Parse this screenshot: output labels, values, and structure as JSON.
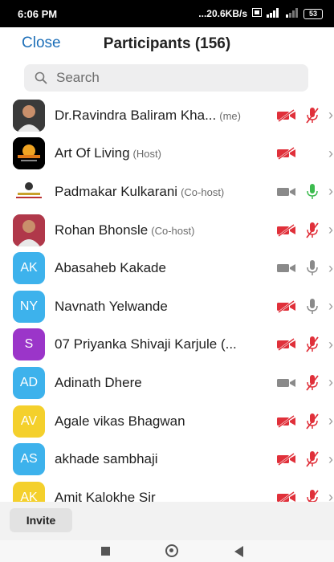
{
  "status_bar": {
    "time": "6:06 PM",
    "net_speed": "...20.6KB/s",
    "battery": "53"
  },
  "header": {
    "close_label": "Close",
    "title": "Participants (156)"
  },
  "search": {
    "placeholder": "Search"
  },
  "colors": {
    "accent_blue": "#1d6fb8",
    "muted_red": "#e0303a",
    "mic_green": "#3dbb4f",
    "icon_gray": "#8a8a8a"
  },
  "participants": [
    {
      "name": "Dr.Ravindra Baliram Kha...",
      "role": "(me)",
      "avatar_type": "photo",
      "avatar_bg": "#3a3a3a",
      "video": "off",
      "mic": "muted"
    },
    {
      "name": "Art Of Living",
      "role": "(Host)",
      "avatar_type": "logo",
      "avatar_bg": "#000000",
      "video": "off",
      "mic": "none"
    },
    {
      "name": "Padmakar Kulkarani",
      "role": "(Co-host)",
      "avatar_type": "logo-light",
      "avatar_bg": "#ffffff",
      "video": "on",
      "mic": "active"
    },
    {
      "name": "Rohan Bhonsle",
      "role": "(Co-host)",
      "avatar_type": "photo",
      "avatar_bg": "#b0384a",
      "video": "off",
      "mic": "muted"
    },
    {
      "name": "Abasaheb Kakade",
      "role": "",
      "avatar_type": "initials",
      "initials": "AK",
      "avatar_bg": "#3db2ec",
      "video": "on",
      "mic": "on"
    },
    {
      "name": "Navnath Yelwande",
      "role": "",
      "avatar_type": "initials",
      "initials": "NY",
      "avatar_bg": "#3db2ec",
      "video": "off",
      "mic": "on"
    },
    {
      "name": "07 Priyanka Shivaji Karjule (...",
      "role": "",
      "avatar_type": "initials",
      "initials": "S",
      "avatar_bg": "#9b35c9",
      "video": "off",
      "mic": "muted"
    },
    {
      "name": "Adinath Dhere",
      "role": "",
      "avatar_type": "initials",
      "initials": "AD",
      "avatar_bg": "#3db2ec",
      "video": "on",
      "mic": "muted"
    },
    {
      "name": "Agale vikas Bhagwan",
      "role": "",
      "avatar_type": "initials",
      "initials": "AV",
      "avatar_bg": "#f4d02c",
      "video": "off",
      "mic": "muted"
    },
    {
      "name": "akhade sambhaji",
      "role": "",
      "avatar_type": "initials",
      "initials": "AS",
      "avatar_bg": "#3db2ec",
      "video": "off",
      "mic": "muted"
    },
    {
      "name": "Amit Kalokhe Sir",
      "role": "",
      "avatar_type": "initials",
      "initials": "AK",
      "avatar_bg": "#f4d02c",
      "video": "off",
      "mic": "muted"
    }
  ],
  "footer": {
    "invite_label": "Invite"
  }
}
